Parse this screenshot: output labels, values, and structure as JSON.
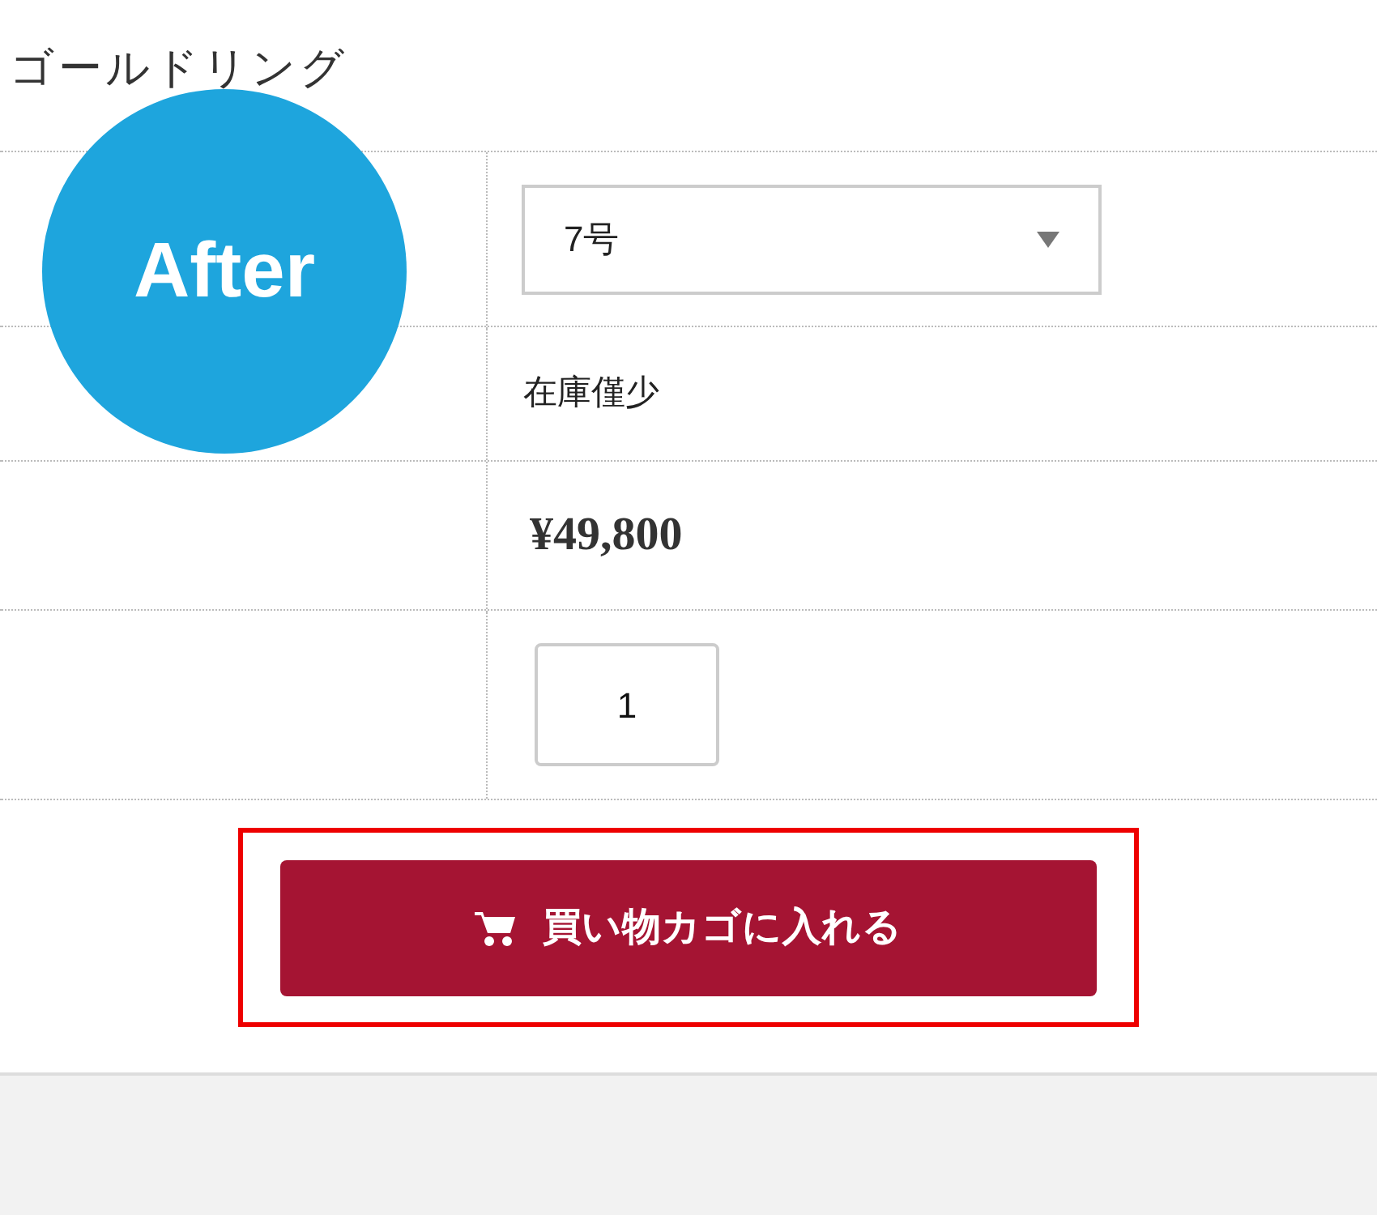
{
  "product_title": "ゴールドリング",
  "badge": "After",
  "size_select": {
    "value": "7号"
  },
  "stock": "在庫僅少",
  "price": "¥49,800",
  "quantity": {
    "value": "1"
  },
  "cart_button": {
    "label": "買い物カゴに入れる",
    "highlighted": true
  }
}
